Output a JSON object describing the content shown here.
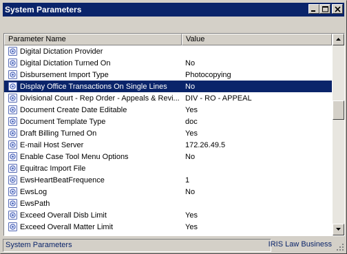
{
  "window": {
    "title": "System Parameters"
  },
  "grid": {
    "columns": [
      {
        "label": "Parameter Name"
      },
      {
        "label": "Value"
      }
    ],
    "rows": [
      {
        "name": "Digital Dictation Provider",
        "value": "",
        "selected": false
      },
      {
        "name": "Digital Dictation Turned On",
        "value": "No",
        "selected": false
      },
      {
        "name": "Disbursement Import Type",
        "value": "Photocopying",
        "selected": false
      },
      {
        "name": "Display Office Transactions On Single Lines",
        "value": "No",
        "selected": true
      },
      {
        "name": "Divisional Court - Rep Order - Appeals & Revi...",
        "value": "DIV - RO - APPEAL",
        "selected": false
      },
      {
        "name": "Document Create Date Editable",
        "value": "Yes",
        "selected": false
      },
      {
        "name": "Document Template Type",
        "value": "doc",
        "selected": false
      },
      {
        "name": "Draft Billing Turned On",
        "value": "Yes",
        "selected": false
      },
      {
        "name": "E-mail Host Server",
        "value": "172.26.49.5",
        "selected": false
      },
      {
        "name": "Enable Case Tool Menu Options",
        "value": "No",
        "selected": false
      },
      {
        "name": "Equitrac Import File",
        "value": "",
        "selected": false
      },
      {
        "name": "EwsHeartBeatFrequence",
        "value": "1",
        "selected": false
      },
      {
        "name": "EwsLog",
        "value": "No",
        "selected": false
      },
      {
        "name": "EwsPath",
        "value": "",
        "selected": false
      },
      {
        "name": "Exceed Overall Disb Limit",
        "value": "Yes",
        "selected": false
      },
      {
        "name": "Exceed Overall Matter Limit",
        "value": "Yes",
        "selected": false
      }
    ]
  },
  "statusbar": {
    "left": "System Parameters",
    "right": "IRIS Law Business"
  },
  "icons": {
    "row_icon": "parameter-icon",
    "accent": "#0a246a"
  }
}
